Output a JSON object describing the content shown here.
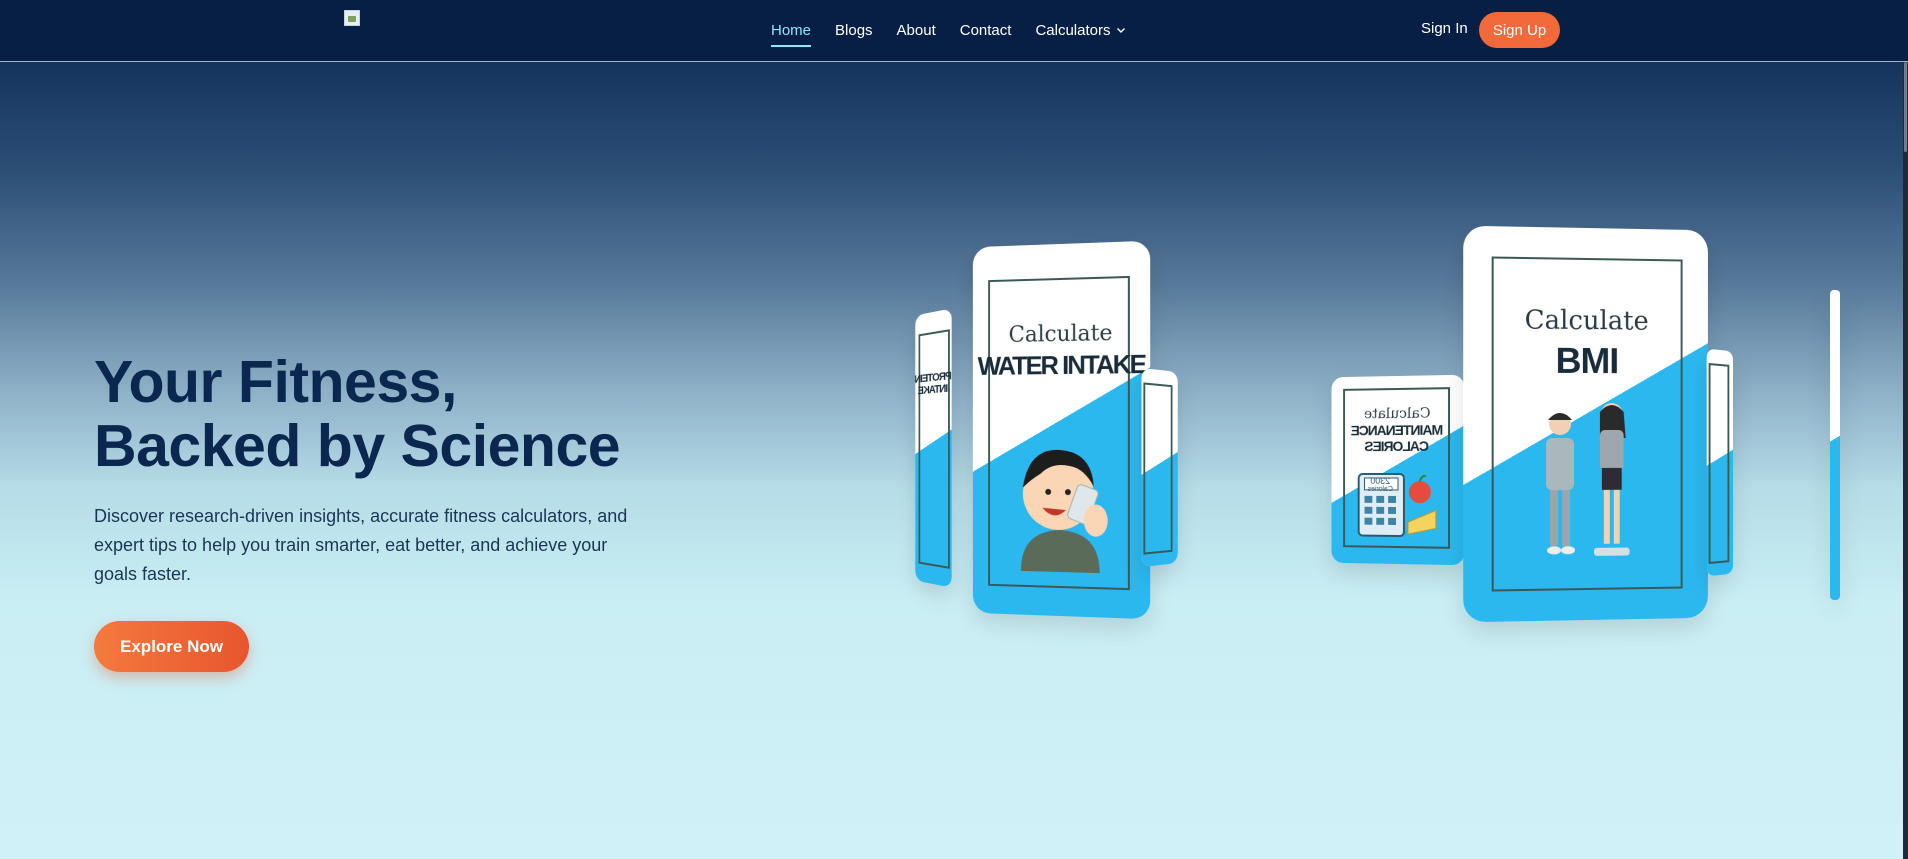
{
  "nav": {
    "links": [
      {
        "label": "Home",
        "active": true
      },
      {
        "label": "Blogs"
      },
      {
        "label": "About"
      },
      {
        "label": "Contact"
      },
      {
        "label": "Calculators",
        "has_dropdown": true
      }
    ],
    "signin_label": "Sign In",
    "signup_label": "Sign Up"
  },
  "hero": {
    "title_line1": "Your Fitness,",
    "title_line2": "Backed by Science",
    "description": "Discover research-driven insights, accurate fitness calculators, and expert tips to help you train smarter, eat better, and achieve your goals faster.",
    "cta_label": "Explore Now"
  },
  "cards": {
    "water": {
      "small": "Calculate",
      "big": "WATER INTAKE"
    },
    "bmi": {
      "small": "Calculate",
      "big": "BMI"
    },
    "maintenance": {
      "small": "Calculate",
      "big1": "MAINTENANCE",
      "big2": "CALORIES",
      "calc_value": "2300",
      "calc_unit": "Calories"
    },
    "protein": {
      "big1": "PROTEIN",
      "big2": "INTAKE"
    }
  },
  "colors": {
    "nav_bg": "#081f45",
    "accent": "#f26a3a",
    "title": "#0b2750",
    "card_blue": "#2bb8ef"
  }
}
